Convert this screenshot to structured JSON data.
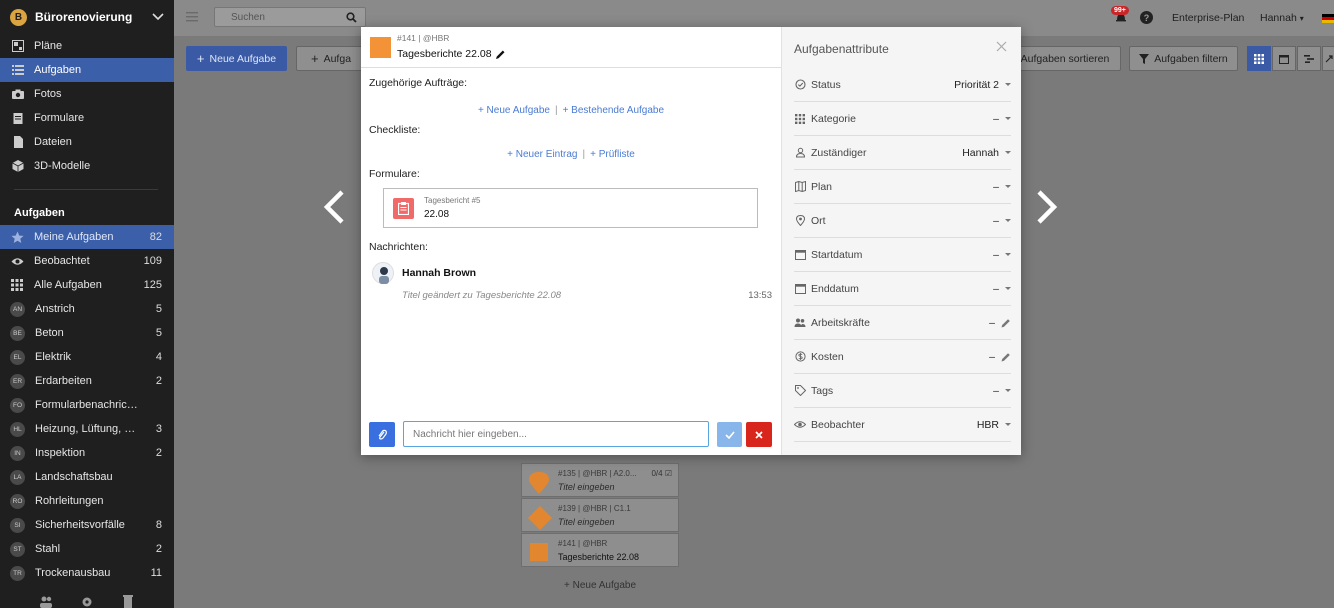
{
  "project": {
    "name": "Bürorenovierung",
    "logo_letter": "B"
  },
  "nav": [
    {
      "label": "Pläne",
      "icon": "plans-icon"
    },
    {
      "label": "Aufgaben",
      "icon": "list-icon",
      "active": true
    },
    {
      "label": "Fotos",
      "icon": "camera-icon"
    },
    {
      "label": "Formulare",
      "icon": "form-icon"
    },
    {
      "label": "Dateien",
      "icon": "file-icon"
    },
    {
      "label": "3D-Modelle",
      "icon": "cube-icon"
    }
  ],
  "tasks_section": {
    "title": "Aufgaben",
    "items": [
      {
        "label": "Meine Aufgaben",
        "count": "82",
        "icon": "star-icon",
        "active": true
      },
      {
        "label": "Beobachtet",
        "count": "109",
        "icon": "eye-icon"
      },
      {
        "label": "Alle Aufgaben",
        "count": "125",
        "icon": "grid-icon"
      },
      {
        "label": "Anstrich",
        "count": "5",
        "abbr": "AN"
      },
      {
        "label": "Beton",
        "count": "5",
        "abbr": "BE"
      },
      {
        "label": "Elektrik",
        "count": "4",
        "abbr": "EL"
      },
      {
        "label": "Erdarbeiten",
        "count": "2",
        "abbr": "ER"
      },
      {
        "label": "Formularbenachrichti...",
        "count": "",
        "abbr": "FO"
      },
      {
        "label": "Heizung, Lüftung, Klima",
        "count": "3",
        "abbr": "HL"
      },
      {
        "label": "Inspektion",
        "count": "2",
        "abbr": "IN"
      },
      {
        "label": "Landschaftsbau",
        "count": "",
        "abbr": "LA"
      },
      {
        "label": "Rohrleitungen",
        "count": "",
        "abbr": "RO"
      },
      {
        "label": "Sicherheitsvorfälle",
        "count": "8",
        "abbr": "SI"
      },
      {
        "label": "Stahl",
        "count": "2",
        "abbr": "ST"
      },
      {
        "label": "Trockenausbau",
        "count": "11",
        "abbr": "TR"
      }
    ]
  },
  "topbar": {
    "search_placeholder": "Suchen",
    "notif_badge": "99+",
    "help": "?",
    "plan_label": "Enterprise-Plan",
    "user_label": "Hannah"
  },
  "toolbar": {
    "new_task": "Neue Aufgabe",
    "new_task2": "Aufga",
    "sort": "Aufgaben sortieren",
    "filter": "Aufgaben filtern"
  },
  "bg_cards": [
    {
      "meta": "#135 | @HBR | A2.0...",
      "title": "Titel eingeben",
      "progress": "0/4",
      "shape": "pin",
      "color": "#e2872f"
    },
    {
      "meta": "#139 | @HBR | C1.1",
      "title": "Titel eingeben",
      "progress": "",
      "shape": "diamond",
      "color": "#e2872f"
    },
    {
      "meta": "#141 | @HBR",
      "title": "Tagesberichte 22.08",
      "progress": "",
      "shape": "square",
      "color": "#e2872f"
    }
  ],
  "bg_add": "+ Neue Aufgabe",
  "modal": {
    "meta": "#141 | @HBR",
    "title": "Tagesberichte 22.08",
    "related_label": "Zugehörige Aufträge:",
    "related_new": "+ Neue Aufgabe",
    "related_existing": "+ Bestehende Aufgabe",
    "checklist_label": "Checkliste:",
    "checklist_new": "+ Neuer Eintrag",
    "checklist_list": "+ Prüfliste",
    "forms_label": "Formulare:",
    "form_meta": "Tagesbericht #5",
    "form_title": "22.08",
    "messages_label": "Nachrichten:",
    "message_author": "Hannah Brown",
    "message_text": "Titel geändert zu Tagesberichte 22.08",
    "message_time": "13:53",
    "input_placeholder": "Nachricht hier eingeben..."
  },
  "attributes": {
    "title": "Aufgabenattribute",
    "rows": [
      {
        "label": "Status",
        "value": "Priorität 2",
        "icon": "status-icon",
        "action": "caret"
      },
      {
        "label": "Kategorie",
        "value": "–",
        "icon": "category-icon",
        "action": "caret"
      },
      {
        "label": "Zuständiger",
        "value": "Hannah",
        "icon": "assignee-icon",
        "action": "caret"
      },
      {
        "label": "Plan",
        "value": "–",
        "icon": "map-icon",
        "action": "caret"
      },
      {
        "label": "Ort",
        "value": "–",
        "icon": "location-icon",
        "action": "caret"
      },
      {
        "label": "Startdatum",
        "value": "–",
        "icon": "calendar-icon",
        "action": "caret"
      },
      {
        "label": "Enddatum",
        "value": "–",
        "icon": "calendar-icon",
        "action": "caret"
      },
      {
        "label": "Arbeitskräfte",
        "value": "–",
        "icon": "workers-icon",
        "action": "edit"
      },
      {
        "label": "Kosten",
        "value": "–",
        "icon": "cost-icon",
        "action": "edit"
      },
      {
        "label": "Tags",
        "value": "–",
        "icon": "tag-icon",
        "action": "caret"
      },
      {
        "label": "Beobachter",
        "value": "HBR",
        "icon": "watcher-icon",
        "action": "caret"
      }
    ]
  },
  "colors": {
    "accent": "#3a5aa6",
    "task_orange": "#f39237",
    "danger": "#d9261c"
  }
}
